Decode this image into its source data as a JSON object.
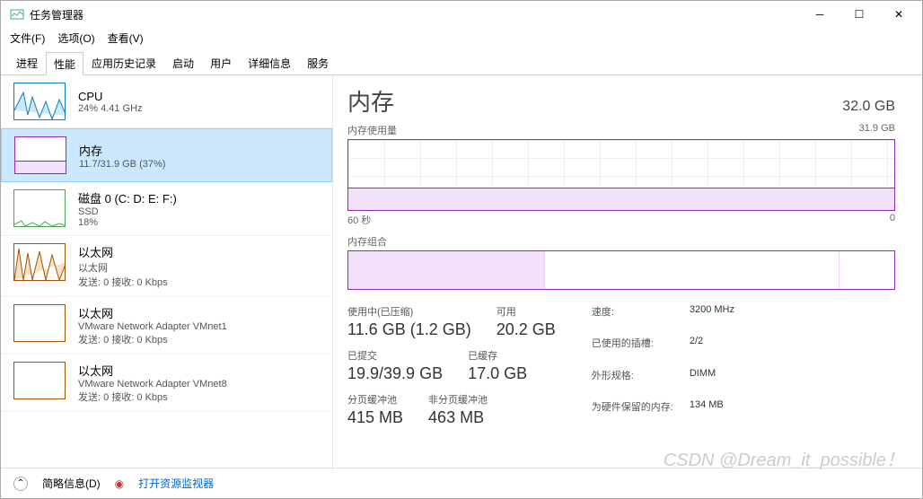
{
  "window": {
    "title": "任务管理器"
  },
  "menu": {
    "file": "文件(F)",
    "options": "选项(O)",
    "view": "查看(V)"
  },
  "tabs": [
    "进程",
    "性能",
    "应用历史记录",
    "启动",
    "用户",
    "详细信息",
    "服务"
  ],
  "active_tab": 1,
  "sidebar": [
    {
      "name": "CPU",
      "sub": "24% 4.41 GHz",
      "type": "cpu"
    },
    {
      "name": "内存",
      "sub": "11.7/31.9 GB (37%)",
      "type": "mem",
      "selected": true
    },
    {
      "name": "磁盘 0 (C: D: E: F:)",
      "sub": "SSD",
      "sub2": "18%",
      "type": "disk"
    },
    {
      "name": "以太网",
      "sub": "以太网",
      "sub2": "发送: 0 接收: 0 Kbps",
      "type": "eth"
    },
    {
      "name": "以太网",
      "sub": "VMware Network Adapter VMnet1",
      "sub2": "发送: 0 接收: 0 Kbps",
      "type": "eth2"
    },
    {
      "name": "以太网",
      "sub": "VMware Network Adapter VMnet8",
      "sub2": "发送: 0 接收: 0 Kbps",
      "type": "eth2"
    }
  ],
  "detail": {
    "title": "内存",
    "total": "32.0 GB",
    "usage_label": "内存使用量",
    "usage_max": "31.9 GB",
    "x_left": "60 秒",
    "x_right": "0",
    "composition_label": "内存组合",
    "stats": {
      "in_use_label": "使用中(已压缩)",
      "in_use": "11.6 GB (1.2 GB)",
      "avail_label": "可用",
      "avail": "20.2 GB",
      "committed_label": "已提交",
      "committed": "19.9/39.9 GB",
      "cached_label": "已缓存",
      "cached": "17.0 GB",
      "paged_label": "分页缓冲池",
      "paged": "415 MB",
      "nonpaged_label": "非分页缓冲池",
      "nonpaged": "463 MB"
    },
    "specs": {
      "speed_label": "速度:",
      "speed": "3200 MHz",
      "slots_label": "已使用的插槽:",
      "slots": "2/2",
      "form_label": "外形规格:",
      "form": "DIMM",
      "reserved_label": "为硬件保留的内存:",
      "reserved": "134 MB"
    }
  },
  "bottom": {
    "brief": "简略信息(D)",
    "monitor": "打开资源监视器"
  },
  "watermark": "CSDN @Dream_it_possible！"
}
